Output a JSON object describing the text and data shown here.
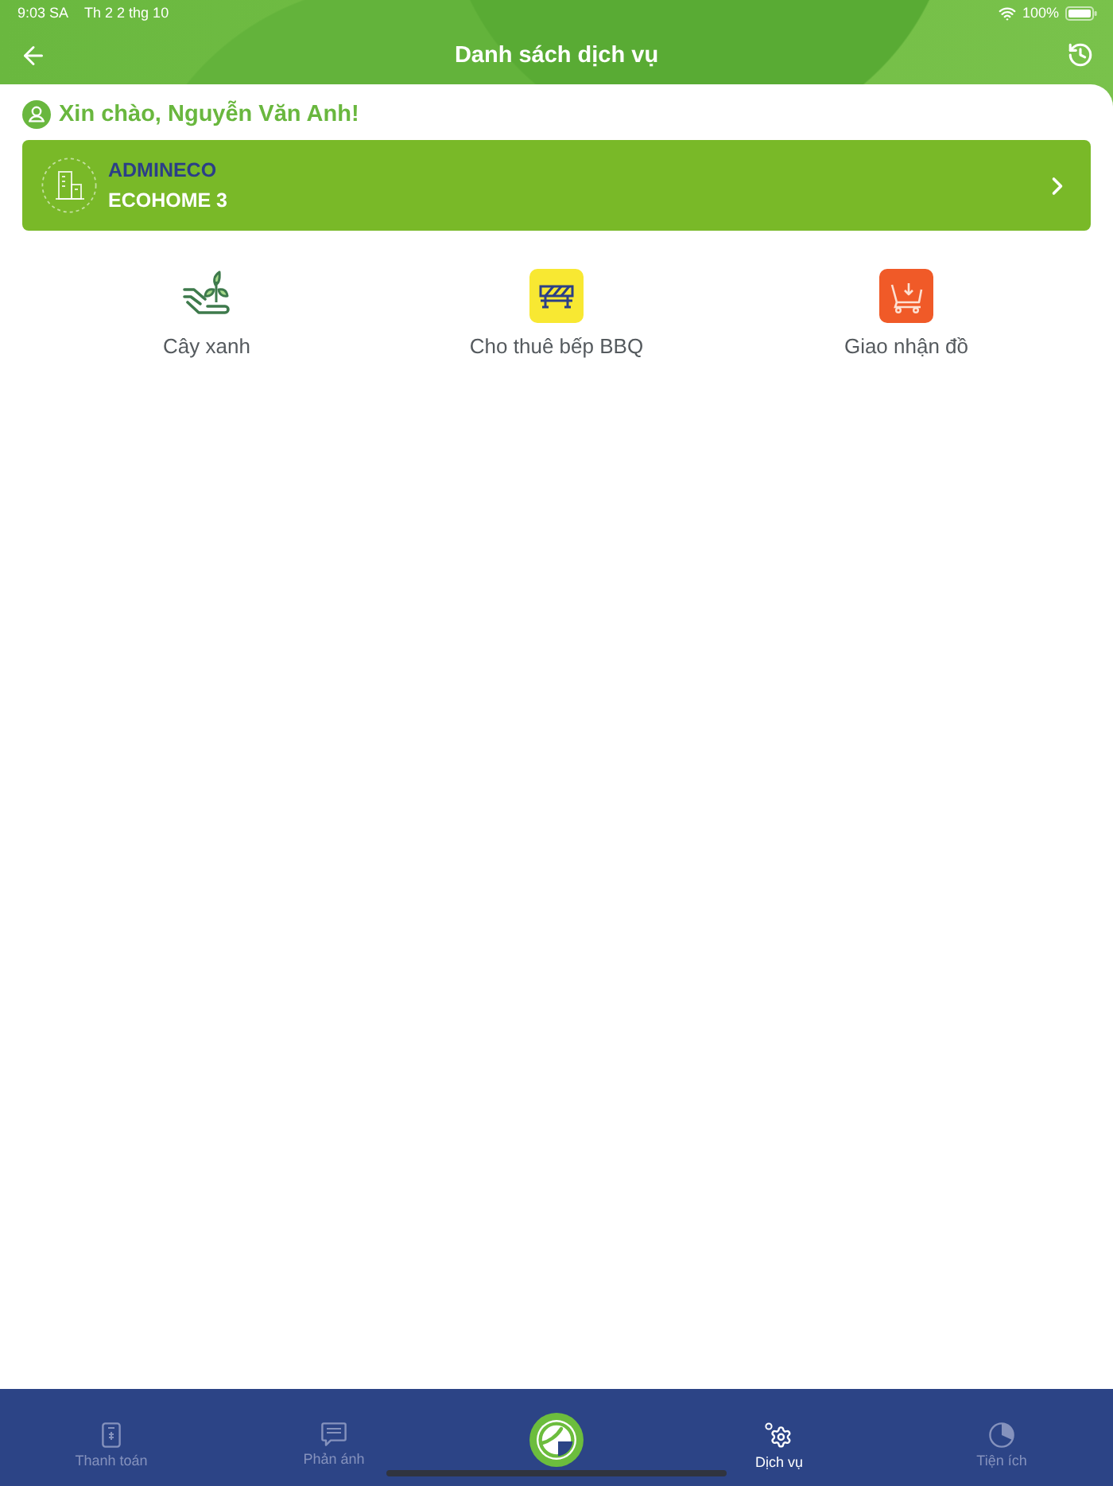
{
  "status_bar": {
    "time": "9:03 SA",
    "date": "Th 2 2 thg 10",
    "battery": "100%"
  },
  "header": {
    "title": "Danh sách dịch vụ"
  },
  "greeting": "Xin chào, Nguyễn Văn Anh!",
  "project": {
    "company": "ADMINECO",
    "building": "ECOHOME 3"
  },
  "services": [
    {
      "label": "Cây xanh",
      "kind": "plant"
    },
    {
      "label": "Cho thuê bếp BBQ",
      "kind": "barrier"
    },
    {
      "label": "Giao nhận đồ",
      "kind": "cart"
    }
  ],
  "tab_bar": {
    "tabs": [
      {
        "label": "Thanh toán",
        "kind": "bill",
        "selected": false
      },
      {
        "label": "Phản ánh",
        "kind": "chat",
        "selected": false
      },
      {
        "kind": "logo",
        "selected": false
      },
      {
        "label": "Dịch vụ",
        "kind": "gear",
        "selected": true
      },
      {
        "label": "Tiện ích",
        "kind": "pie",
        "selected": false
      }
    ]
  }
}
